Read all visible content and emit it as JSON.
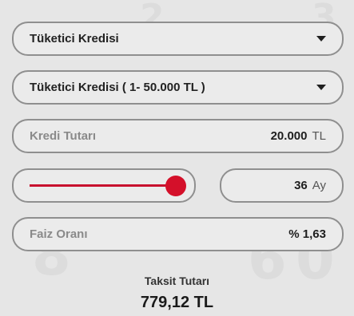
{
  "product_select": {
    "value": "Tüketici Kredisi"
  },
  "range_select": {
    "value": "Tüketici Kredisi ( 1- 50.000 TL )"
  },
  "amount": {
    "label": "Kredi Tutarı",
    "value": "20.000",
    "unit": "TL"
  },
  "term": {
    "value": "36",
    "unit": "Ay",
    "slider_level": 1.0
  },
  "interest": {
    "label": "Faiz Oranı",
    "value": "% 1,63"
  },
  "installment": {
    "label": "Taksit Tutarı",
    "value": "779,12 TL"
  },
  "colors": {
    "accent": "#d4102a",
    "background": "#e6e6e6",
    "border": "#8f8f8f"
  },
  "icons": {
    "dropdown": "chevron-down-icon"
  }
}
